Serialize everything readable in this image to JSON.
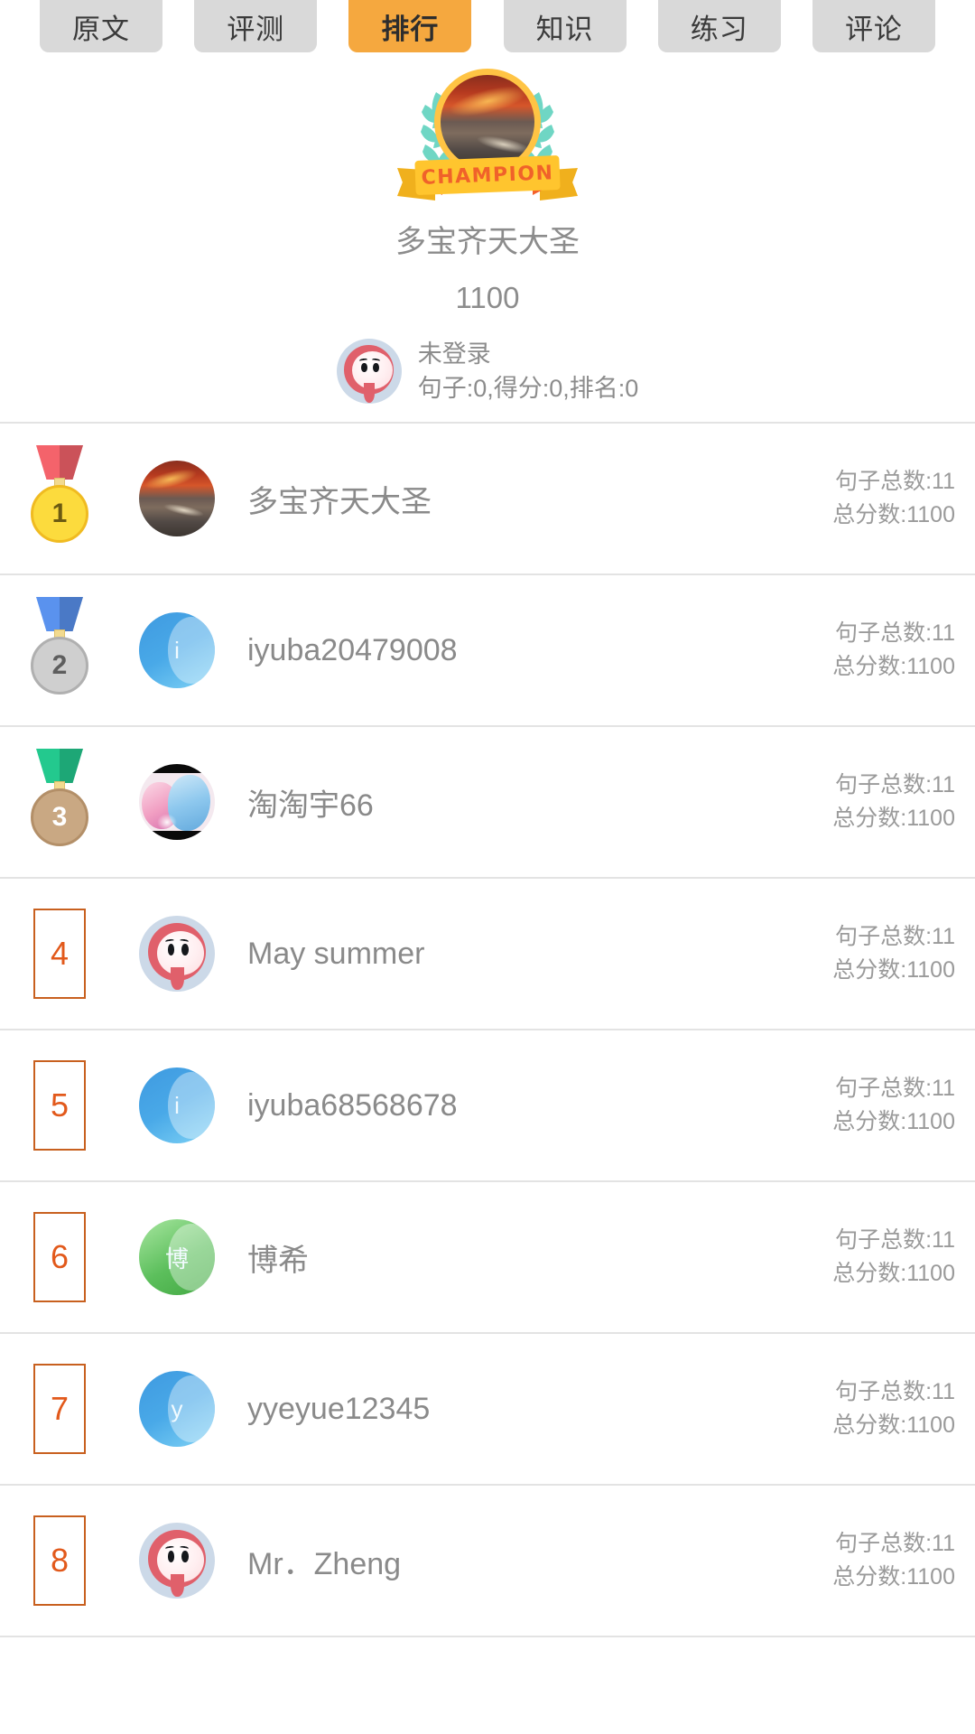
{
  "tabs": [
    {
      "label": "原文",
      "active": false
    },
    {
      "label": "评测",
      "active": false
    },
    {
      "label": "排行",
      "active": true
    },
    {
      "label": "知识",
      "active": false
    },
    {
      "label": "练习",
      "active": false
    },
    {
      "label": "评论",
      "active": false
    }
  ],
  "champion": {
    "ribbon_label": "CHAMPION",
    "name": "多宝齐天大圣",
    "score": "1100",
    "avatar_icon": "game-photo-avatar"
  },
  "current_user": {
    "name": "未登录",
    "stats": "句子:0,得分:0,排名:0",
    "avatar_icon": "hood-character-avatar"
  },
  "colors": {
    "accent_orange": "#f5a83f",
    "tab_gray": "#d9d9d9",
    "rank_box_border": "#c8601f",
    "rank_box_text": "#e2591b",
    "text_gray": "#8a8a8a",
    "divider": "#e3e3e3",
    "medal_gold": "#fcdb3d",
    "medal_silver": "#cfcfcf",
    "medal_bronze": "#c9a883",
    "ribbon_red": "#f4636b",
    "ribbon_blue": "#5a92ee",
    "ribbon_green": "#23c98e"
  },
  "ranking": [
    {
      "rank": "1",
      "medal": true,
      "medal_class": "m1",
      "ribbon_color": "#f4636b",
      "avatar_icon": "game-photo-avatar",
      "avatar_type": "photo",
      "avatar_letter": "",
      "name": "多宝齐天大圣",
      "sentences": "句子总数:11",
      "score": "总分数:1100"
    },
    {
      "rank": "2",
      "medal": true,
      "medal_class": "m2",
      "ribbon_color": "#5a92ee",
      "avatar_icon": "letter-avatar-i",
      "avatar_type": "letter",
      "avatar_letter": "i",
      "name": "iyuba20479008",
      "sentences": "句子总数:11",
      "score": "总分数:1100"
    },
    {
      "rank": "3",
      "medal": true,
      "medal_class": "m3",
      "ribbon_color": "#23c98e",
      "avatar_icon": "anime-art-avatar",
      "avatar_type": "anime",
      "avatar_letter": "",
      "name": "淘淘宇66",
      "sentences": "句子总数:11",
      "score": "总分数:1100"
    },
    {
      "rank": "4",
      "medal": false,
      "medal_class": "",
      "ribbon_color": "",
      "avatar_icon": "hood-character-avatar",
      "avatar_type": "hood",
      "avatar_letter": "",
      "name": "May  summer",
      "sentences": "句子总数:11",
      "score": "总分数:1100"
    },
    {
      "rank": "5",
      "medal": false,
      "medal_class": "",
      "ribbon_color": "",
      "avatar_icon": "letter-avatar-i",
      "avatar_type": "letter",
      "avatar_letter": "i",
      "name": "iyuba68568678",
      "sentences": "句子总数:11",
      "score": "总分数:1100"
    },
    {
      "rank": "6",
      "medal": false,
      "medal_class": "",
      "ribbon_color": "",
      "avatar_icon": "letter-avatar-bo",
      "avatar_type": "green",
      "avatar_letter": "博",
      "name": "博希",
      "sentences": "句子总数:11",
      "score": "总分数:1100"
    },
    {
      "rank": "7",
      "medal": false,
      "medal_class": "",
      "ribbon_color": "",
      "avatar_icon": "letter-avatar-y",
      "avatar_type": "letter",
      "avatar_letter": "y",
      "name": "yyeyue12345",
      "sentences": "句子总数:11",
      "score": "总分数:1100"
    },
    {
      "rank": "8",
      "medal": false,
      "medal_class": "",
      "ribbon_color": "",
      "avatar_icon": "hood-character-avatar",
      "avatar_type": "hood",
      "avatar_letter": "",
      "name": "Mr．Zheng",
      "sentences": "句子总数:11",
      "score": "总分数:1100"
    }
  ]
}
